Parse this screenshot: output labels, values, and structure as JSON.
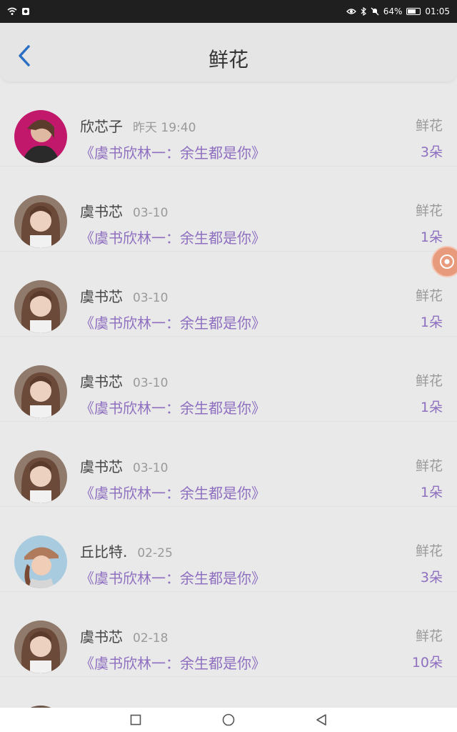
{
  "status_bar": {
    "time": "01:05",
    "battery": "64%"
  },
  "header": {
    "title": "鲜花"
  },
  "records": [
    {
      "name": "欣芯子",
      "time": "昨天 19:40",
      "book": "《虞书欣林一：余生都是你》",
      "gift": "鲜花",
      "count": "3朵",
      "avatar": "avatar-a"
    },
    {
      "name": "虞书芯",
      "time": "03-10",
      "book": "《虞书欣林一：余生都是你》",
      "gift": "鲜花",
      "count": "1朵",
      "avatar": "avatar-b"
    },
    {
      "name": "虞书芯",
      "time": "03-10",
      "book": "《虞书欣林一：余生都是你》",
      "gift": "鲜花",
      "count": "1朵",
      "avatar": "avatar-b"
    },
    {
      "name": "虞书芯",
      "time": "03-10",
      "book": "《虞书欣林一：余生都是你》",
      "gift": "鲜花",
      "count": "1朵",
      "avatar": "avatar-b"
    },
    {
      "name": "虞书芯",
      "time": "03-10",
      "book": "《虞书欣林一：余生都是你》",
      "gift": "鲜花",
      "count": "1朵",
      "avatar": "avatar-b"
    },
    {
      "name": "丘比特.",
      "time": "02-25",
      "book": "《虞书欣林一：余生都是你》",
      "gift": "鲜花",
      "count": "3朵",
      "avatar": "avatar-c"
    },
    {
      "name": "虞书芯",
      "time": "02-18",
      "book": "《虞书欣林一：余生都是你》",
      "gift": "鲜花",
      "count": "10朵",
      "avatar": "avatar-b"
    }
  ],
  "colors": {
    "accent": "#8e6fc0",
    "back": "#2a6fc4"
  }
}
